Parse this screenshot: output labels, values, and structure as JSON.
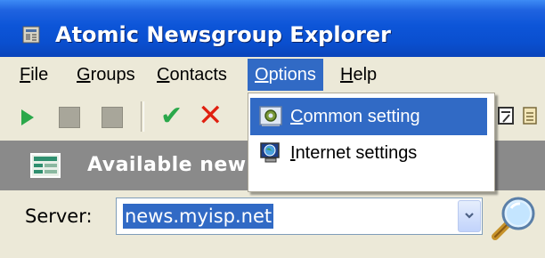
{
  "window": {
    "title": "Atomic Newsgroup Explorer",
    "icon": "newspaper-icon"
  },
  "menubar": {
    "items": [
      {
        "accel": "F",
        "rest": "ile"
      },
      {
        "accel": "G",
        "rest": "roups"
      },
      {
        "accel": "C",
        "rest": "ontacts"
      },
      {
        "accel": "O",
        "rest": "ptions",
        "open": true
      },
      {
        "accel": "H",
        "rest": "elp"
      }
    ]
  },
  "options_menu": {
    "items": [
      {
        "accel": "C",
        "rest": "ommon setting",
        "icon": "settings-gear-icon",
        "highlighted": true
      },
      {
        "accel": "I",
        "rest": "nternet settings",
        "icon": "globe-computer-icon",
        "highlighted": false
      }
    ]
  },
  "toolbar": {
    "icons": [
      "play-icon",
      "stop-icon",
      "stop-icon",
      "checkmark-icon",
      "close-icon",
      "calendar-icon",
      "notepad-icon"
    ]
  },
  "panel": {
    "title": "Available newsgroups",
    "visible_title": "Available new",
    "icon": "newsgroup-list-icon"
  },
  "server": {
    "label": "Server:",
    "value": "news.myisp.net"
  },
  "colors": {
    "titlebar": "#0a4fcf",
    "selection": "#316ac5",
    "panel_header": "#8a8a8a",
    "window_bg": "#ece9d8"
  }
}
